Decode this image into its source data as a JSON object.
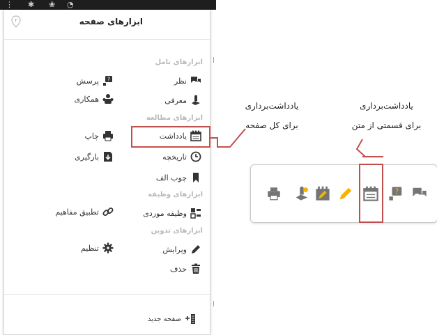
{
  "panel": {
    "title": "ابزارهای صفحه",
    "pin_number": "۲",
    "sections": {
      "interaction": "ابزارهای تامل",
      "study": "ابزارهای مطالعه",
      "task": "ابزارهای وظیفه",
      "authoring": "ابزارهای تدوین"
    },
    "items": {
      "comment": "نظر",
      "question": "پرسش",
      "introduce": "معرفی",
      "collaboration": "همکاری",
      "note": "یادداشت",
      "print": "چاپ",
      "history": "تاریخچه",
      "download": "بارگیری",
      "bookmark": "چوب الف",
      "case_task": "وظیفه موردی",
      "concept_map": "تطبیق مفاهیم",
      "edit": "ویرایش",
      "settings": "تنظیم",
      "delete": "حذف",
      "new_page": "صفحه جدید"
    }
  },
  "annotations": {
    "whole_page_line1": "یادداشت‌برداری",
    "whole_page_line2": "برای کل صفحه",
    "partial_line1": "یادداشت‌برداری",
    "partial_line2": "برای قسمتی از متن"
  },
  "colors": {
    "highlight": "#c0504d",
    "icon": "#333333",
    "toolbar_icon": "#757575",
    "pencil": "#f5b400"
  },
  "icons": [
    "comment-icon",
    "question-icon",
    "introduce-icon",
    "collaboration-icon",
    "note-icon",
    "print-icon",
    "history-icon",
    "download-icon",
    "bookmark-icon",
    "case-task-icon",
    "link-icon",
    "pencil-icon",
    "gear-icon",
    "trash-icon",
    "new-page-icon",
    "highlight-pen-icon"
  ]
}
